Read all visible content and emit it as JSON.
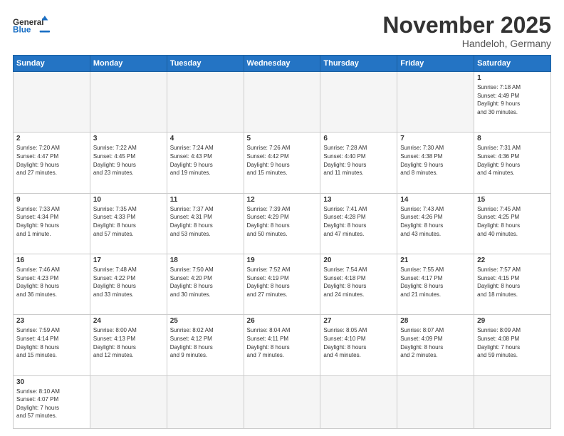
{
  "header": {
    "logo_general": "General",
    "logo_blue": "Blue",
    "month_title": "November 2025",
    "location": "Handeloh, Germany"
  },
  "weekdays": [
    "Sunday",
    "Monday",
    "Tuesday",
    "Wednesday",
    "Thursday",
    "Friday",
    "Saturday"
  ],
  "weeks": [
    [
      {
        "day": "",
        "info": ""
      },
      {
        "day": "",
        "info": ""
      },
      {
        "day": "",
        "info": ""
      },
      {
        "day": "",
        "info": ""
      },
      {
        "day": "",
        "info": ""
      },
      {
        "day": "",
        "info": ""
      },
      {
        "day": "1",
        "info": "Sunrise: 7:18 AM\nSunset: 4:49 PM\nDaylight: 9 hours\nand 30 minutes."
      }
    ],
    [
      {
        "day": "2",
        "info": "Sunrise: 7:20 AM\nSunset: 4:47 PM\nDaylight: 9 hours\nand 27 minutes."
      },
      {
        "day": "3",
        "info": "Sunrise: 7:22 AM\nSunset: 4:45 PM\nDaylight: 9 hours\nand 23 minutes."
      },
      {
        "day": "4",
        "info": "Sunrise: 7:24 AM\nSunset: 4:43 PM\nDaylight: 9 hours\nand 19 minutes."
      },
      {
        "day": "5",
        "info": "Sunrise: 7:26 AM\nSunset: 4:42 PM\nDaylight: 9 hours\nand 15 minutes."
      },
      {
        "day": "6",
        "info": "Sunrise: 7:28 AM\nSunset: 4:40 PM\nDaylight: 9 hours\nand 11 minutes."
      },
      {
        "day": "7",
        "info": "Sunrise: 7:30 AM\nSunset: 4:38 PM\nDaylight: 9 hours\nand 8 minutes."
      },
      {
        "day": "8",
        "info": "Sunrise: 7:31 AM\nSunset: 4:36 PM\nDaylight: 9 hours\nand 4 minutes."
      }
    ],
    [
      {
        "day": "9",
        "info": "Sunrise: 7:33 AM\nSunset: 4:34 PM\nDaylight: 9 hours\nand 1 minute."
      },
      {
        "day": "10",
        "info": "Sunrise: 7:35 AM\nSunset: 4:33 PM\nDaylight: 8 hours\nand 57 minutes."
      },
      {
        "day": "11",
        "info": "Sunrise: 7:37 AM\nSunset: 4:31 PM\nDaylight: 8 hours\nand 53 minutes."
      },
      {
        "day": "12",
        "info": "Sunrise: 7:39 AM\nSunset: 4:29 PM\nDaylight: 8 hours\nand 50 minutes."
      },
      {
        "day": "13",
        "info": "Sunrise: 7:41 AM\nSunset: 4:28 PM\nDaylight: 8 hours\nand 47 minutes."
      },
      {
        "day": "14",
        "info": "Sunrise: 7:43 AM\nSunset: 4:26 PM\nDaylight: 8 hours\nand 43 minutes."
      },
      {
        "day": "15",
        "info": "Sunrise: 7:45 AM\nSunset: 4:25 PM\nDaylight: 8 hours\nand 40 minutes."
      }
    ],
    [
      {
        "day": "16",
        "info": "Sunrise: 7:46 AM\nSunset: 4:23 PM\nDaylight: 8 hours\nand 36 minutes."
      },
      {
        "day": "17",
        "info": "Sunrise: 7:48 AM\nSunset: 4:22 PM\nDaylight: 8 hours\nand 33 minutes."
      },
      {
        "day": "18",
        "info": "Sunrise: 7:50 AM\nSunset: 4:20 PM\nDaylight: 8 hours\nand 30 minutes."
      },
      {
        "day": "19",
        "info": "Sunrise: 7:52 AM\nSunset: 4:19 PM\nDaylight: 8 hours\nand 27 minutes."
      },
      {
        "day": "20",
        "info": "Sunrise: 7:54 AM\nSunset: 4:18 PM\nDaylight: 8 hours\nand 24 minutes."
      },
      {
        "day": "21",
        "info": "Sunrise: 7:55 AM\nSunset: 4:17 PM\nDaylight: 8 hours\nand 21 minutes."
      },
      {
        "day": "22",
        "info": "Sunrise: 7:57 AM\nSunset: 4:15 PM\nDaylight: 8 hours\nand 18 minutes."
      }
    ],
    [
      {
        "day": "23",
        "info": "Sunrise: 7:59 AM\nSunset: 4:14 PM\nDaylight: 8 hours\nand 15 minutes."
      },
      {
        "day": "24",
        "info": "Sunrise: 8:00 AM\nSunset: 4:13 PM\nDaylight: 8 hours\nand 12 minutes."
      },
      {
        "day": "25",
        "info": "Sunrise: 8:02 AM\nSunset: 4:12 PM\nDaylight: 8 hours\nand 9 minutes."
      },
      {
        "day": "26",
        "info": "Sunrise: 8:04 AM\nSunset: 4:11 PM\nDaylight: 8 hours\nand 7 minutes."
      },
      {
        "day": "27",
        "info": "Sunrise: 8:05 AM\nSunset: 4:10 PM\nDaylight: 8 hours\nand 4 minutes."
      },
      {
        "day": "28",
        "info": "Sunrise: 8:07 AM\nSunset: 4:09 PM\nDaylight: 8 hours\nand 2 minutes."
      },
      {
        "day": "29",
        "info": "Sunrise: 8:09 AM\nSunset: 4:08 PM\nDaylight: 7 hours\nand 59 minutes."
      }
    ],
    [
      {
        "day": "30",
        "info": "Sunrise: 8:10 AM\nSunset: 4:07 PM\nDaylight: 7 hours\nand 57 minutes."
      },
      {
        "day": "",
        "info": ""
      },
      {
        "day": "",
        "info": ""
      },
      {
        "day": "",
        "info": ""
      },
      {
        "day": "",
        "info": ""
      },
      {
        "day": "",
        "info": ""
      },
      {
        "day": "",
        "info": ""
      }
    ]
  ]
}
